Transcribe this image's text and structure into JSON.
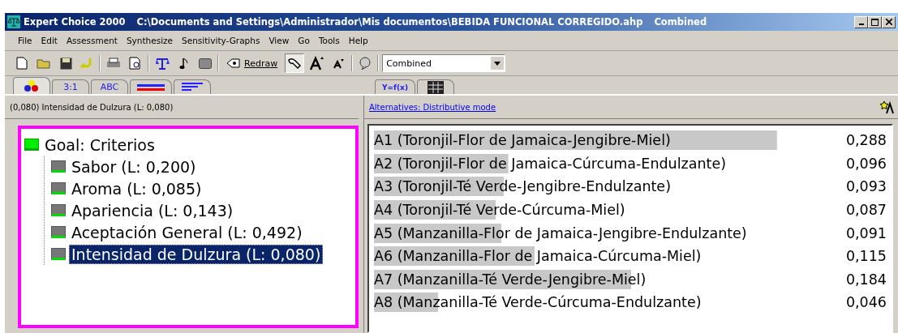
{
  "window": {
    "title": "Expert Choice 2000",
    "path": "C:\\Documents and Settings\\Administrador\\Mis documentos\\BEBIDA FUNCIONAL CORREGIDO.ahp",
    "mode": "Combined"
  },
  "menu": [
    "File",
    "Edit",
    "Assessment",
    "Synthesize",
    "Sensitivity-Graphs",
    "View",
    "Go",
    "Tools",
    "Help"
  ],
  "toolbar": {
    "redraw": "Redraw",
    "combo": "Combined"
  },
  "tabs": [
    {
      "kind": "balls",
      "selected": true
    },
    {
      "kind": "text",
      "label": "3:1",
      "selected": false
    },
    {
      "kind": "text",
      "label": "ABC",
      "selected": false
    },
    {
      "kind": "bars",
      "selected": false
    },
    {
      "kind": "lines",
      "selected": false
    }
  ],
  "tabs_right": [
    {
      "kind": "text",
      "label": "Y=f(x)",
      "selected": false
    },
    {
      "kind": "grid",
      "selected": false
    }
  ],
  "left_header": "(0,080)  Intensidad de Dulzura (L: 0,080)",
  "right_header": "Alternatives: Distributive mode",
  "tree": {
    "label": "Goal: Criterios",
    "children": [
      {
        "label": "Sabor (L: 0,200)",
        "selected": false
      },
      {
        "label": "Aroma (L: 0,085)",
        "selected": false
      },
      {
        "label": "Apariencia (L: 0,143)",
        "selected": false
      },
      {
        "label": "Aceptación General (L: 0,492)",
        "selected": false
      },
      {
        "label": "Intensidad de Dulzura (L: 0,080)",
        "selected": true
      }
    ]
  },
  "alternatives": [
    {
      "name": "A1 (Toronjil-Flor de Jamaica-Jengibre-Miel)",
      "value": "0,288"
    },
    {
      "name": "A2 (Toronjil-Flor de Jamaica-Cúrcuma-Endulzante)",
      "value": "0,096"
    },
    {
      "name": "A3 (Toronjil-Té Verde-Jengibre-Endulzante)",
      "value": "0,093"
    },
    {
      "name": "A4 (Toronjil-Té Verde-Cúrcuma-Miel)",
      "value": "0,087"
    },
    {
      "name": "A5 (Manzanilla-Flor de Jamaica-Jengibre-Endulzante)",
      "value": "0,091"
    },
    {
      "name": "A6 (Manzanilla-Flor de Jamaica-Cúrcuma-Miel)",
      "value": "0,115"
    },
    {
      "name": "A7 (Manzanilla-Té Verde-Jengibre-Miel)",
      "value": "0,184"
    },
    {
      "name": "A8 (Manzanilla-Té Verde-Cúrcuma-Endulzante)",
      "value": "0,046"
    }
  ]
}
